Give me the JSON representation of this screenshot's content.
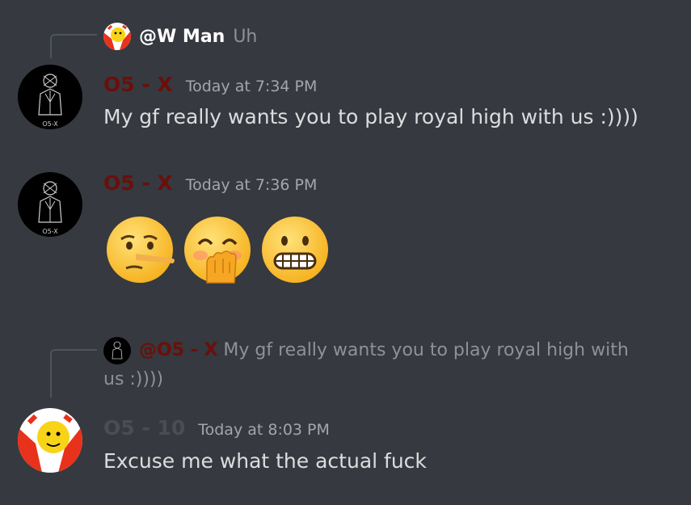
{
  "messages": [
    {
      "reply": {
        "author": "@W Man",
        "text": "Uh"
      },
      "author": "O5 - X",
      "author_color": "#6b0f0a",
      "timestamp": "Today at 7:34 PM",
      "content": "My gf really wants you to play royal high with us :))))",
      "avatar_label": "O5-X"
    },
    {
      "author": "O5 - X",
      "author_color": "#6b0f0a",
      "timestamp": "Today at 7:36 PM",
      "emojis": [
        "lying-face",
        "face-with-hand-over-mouth",
        "grimacing-face"
      ],
      "avatar_label": "O5-X"
    },
    {
      "reply": {
        "author": "@O5 - X",
        "text_line1": "My gf really wants you to play royal high with",
        "text_line2": "us :))))"
      },
      "author": "O5 - 10",
      "author_color": "#4a4d52",
      "timestamp": "Today at 8:03 PM",
      "content": "Excuse me what the actual fuck"
    }
  ]
}
